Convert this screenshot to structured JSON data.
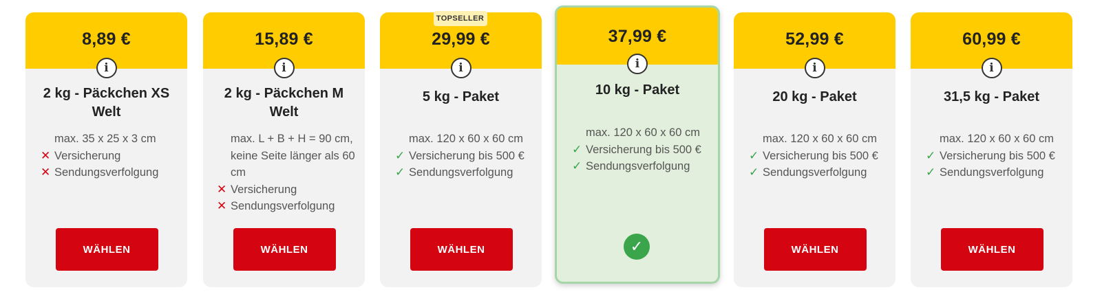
{
  "products": [
    {
      "price": "8,89 €",
      "title": "2 kg - Päckchen XS Welt",
      "dims": "max. 35 x 25 x 3 cm",
      "features": [
        {
          "type": "cross",
          "text": "Versicherung"
        },
        {
          "type": "cross",
          "text": "Sendungsverfolgung"
        }
      ],
      "button": "WÄHLEN"
    },
    {
      "price": "15,89 €",
      "title": "2 kg - Päckchen M Welt",
      "dims": "max. L + B + H = 90 cm, keine Seite länger als 60 cm",
      "features": [
        {
          "type": "cross",
          "text": "Versicherung"
        },
        {
          "type": "cross",
          "text": "Sendungsverfolgung"
        }
      ],
      "button": "WÄHLEN"
    },
    {
      "badge": "TOPSELLER",
      "price": "29,99 €",
      "title": "5 kg - Paket",
      "dims": "max. 120 x 60 x 60 cm",
      "features": [
        {
          "type": "check",
          "text": "Versicherung bis 500 €"
        },
        {
          "type": "check",
          "text": "Sendungsverfolgung"
        }
      ],
      "button": "WÄHLEN"
    },
    {
      "selected": true,
      "price": "37,99 €",
      "title": "10 kg - Paket",
      "dims": "max. 120 x 60 x 60 cm",
      "features": [
        {
          "type": "check",
          "text": "Versicherung bis 500 €"
        },
        {
          "type": "check",
          "text": "Sendungsverfolgung"
        }
      ]
    },
    {
      "price": "52,99 €",
      "title": "20 kg - Paket",
      "dims": "max. 120 x 60 x 60 cm",
      "features": [
        {
          "type": "check",
          "text": "Versicherung bis 500 €"
        },
        {
          "type": "check",
          "text": "Sendungsverfolgung"
        }
      ],
      "button": "WÄHLEN"
    },
    {
      "price": "60,99 €",
      "title": "31,5 kg - Paket",
      "dims": "max. 120 x 60 x 60 cm",
      "features": [
        {
          "type": "check",
          "text": "Versicherung bis 500 €"
        },
        {
          "type": "check",
          "text": "Sendungsverfolgung"
        }
      ],
      "button": "WÄHLEN"
    }
  ],
  "icons": {
    "info": "info-icon",
    "check": "check-icon",
    "cross": "cross-icon",
    "selected": "selected-check-icon"
  },
  "colors": {
    "price_header": "#ffcc00",
    "button": "#d40511",
    "check": "#3aa54b",
    "cross": "#d40511",
    "selected_bg": "#e1efdc",
    "selected_border": "#a5d6a7"
  }
}
